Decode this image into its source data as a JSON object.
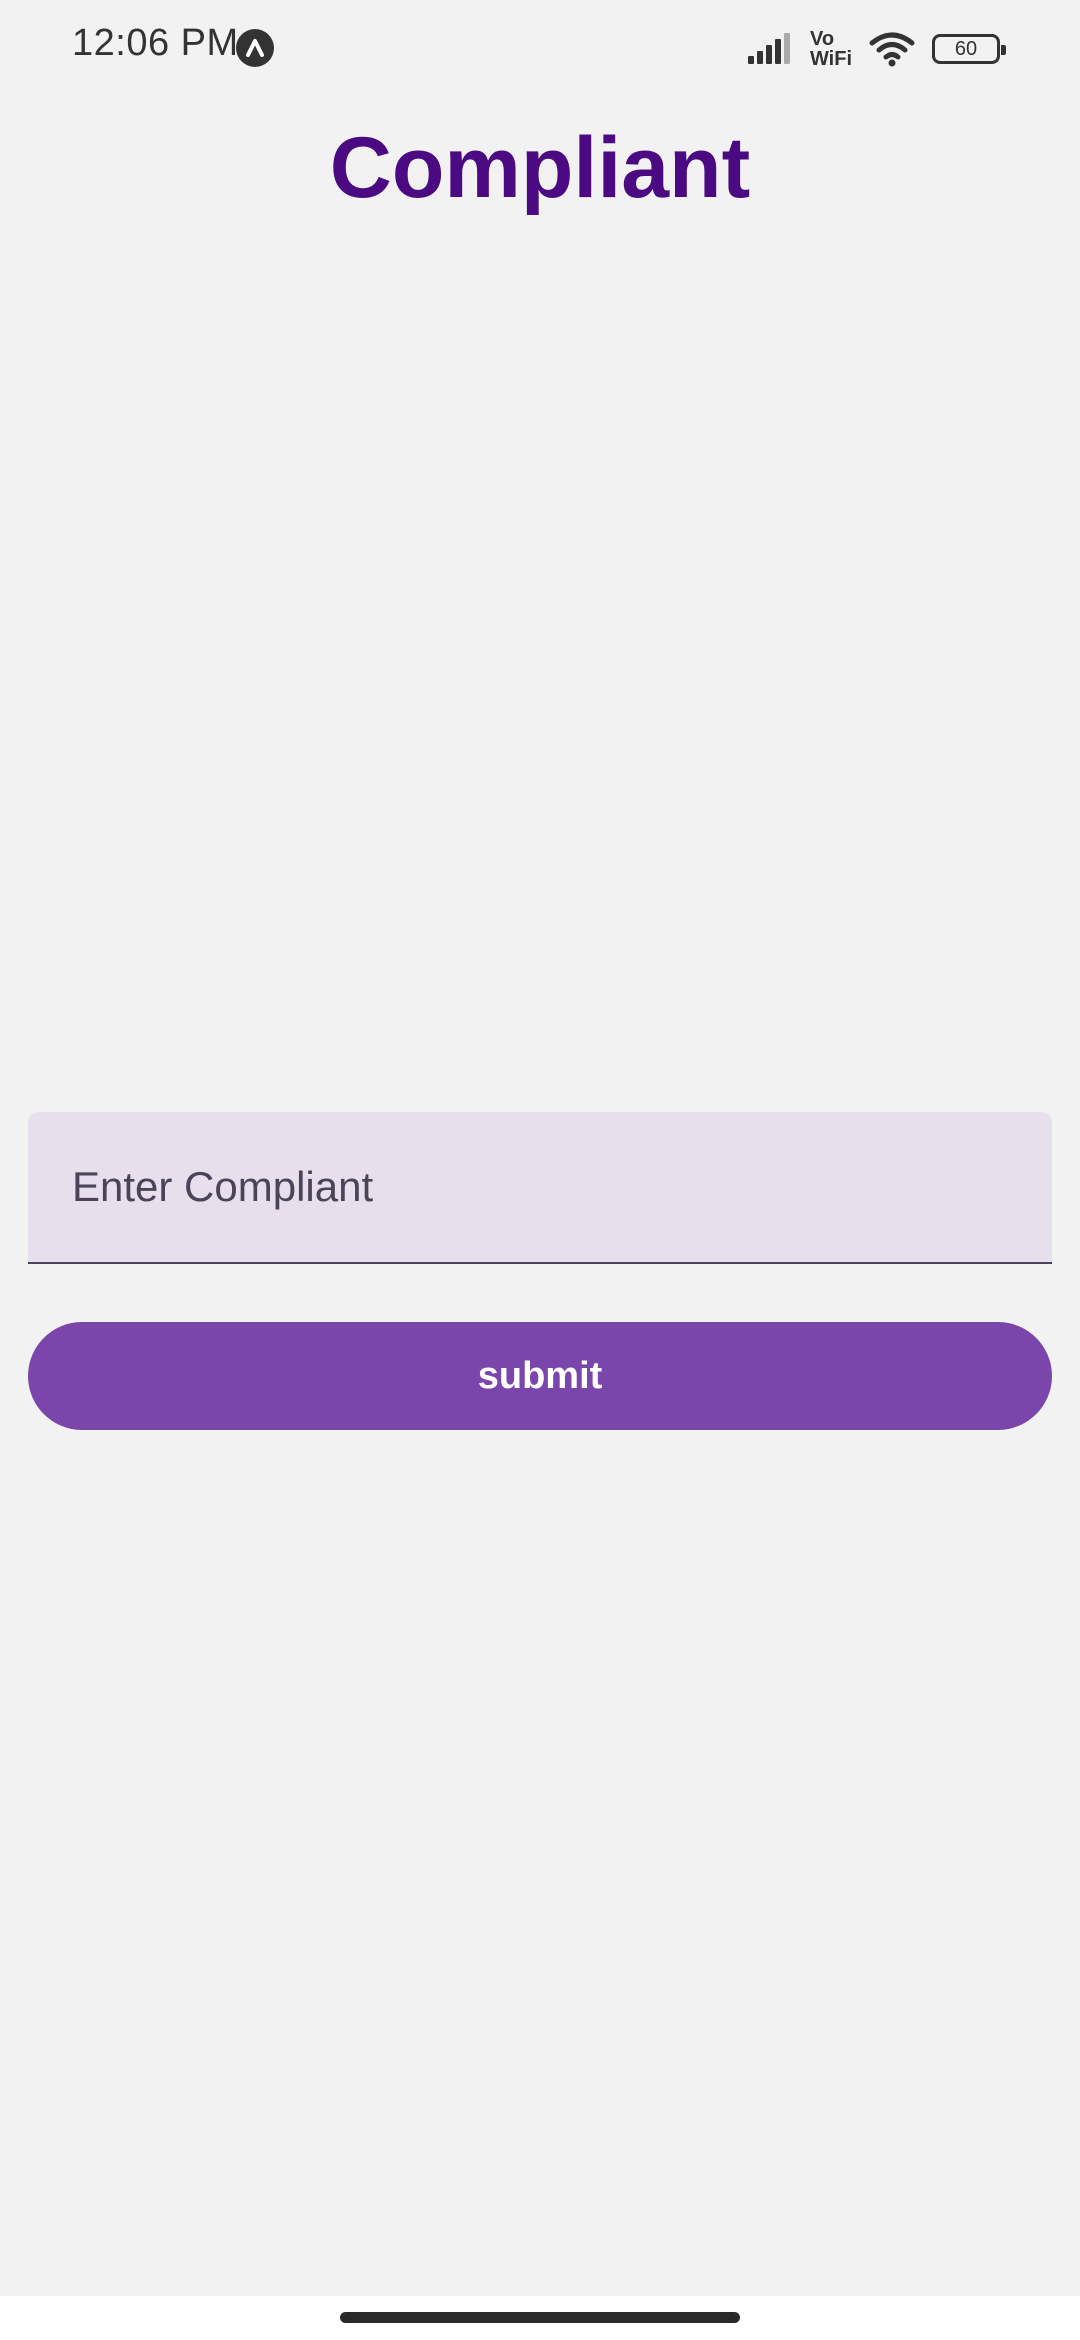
{
  "status_bar": {
    "time": "12:06 PM",
    "vowifi_line1": "Vo",
    "vowifi_line2": "WiFi",
    "battery_level": "60",
    "icons": [
      "notification-icon",
      "signal-icon",
      "vowifi-icon",
      "wifi-icon",
      "battery-icon"
    ]
  },
  "page": {
    "title": "Compliant"
  },
  "form": {
    "complaint_placeholder": "Enter Compliant",
    "complaint_value": "",
    "submit_label": "submit"
  },
  "colors": {
    "title": "#4b0a82",
    "button": "#7a46ab",
    "field_background": "#e7dfec",
    "background": "#f2f2f2"
  }
}
